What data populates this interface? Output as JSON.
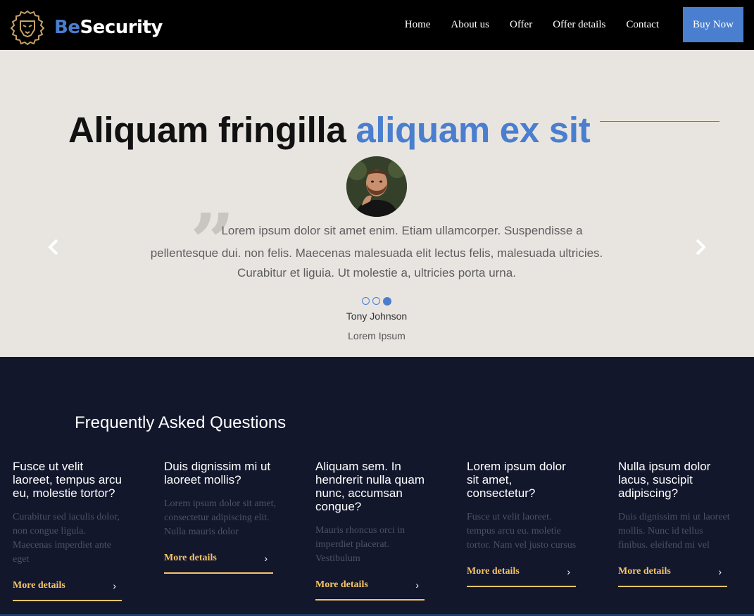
{
  "header": {
    "logo": {
      "be": "Be",
      "rest": "Security"
    },
    "nav": [
      "Home",
      "About us",
      "Offer",
      "Offer details",
      "Contact"
    ],
    "buy_now": "Buy Now"
  },
  "testimonial": {
    "title_main": "Aliquam fringilla",
    "title_accent": "aliquam ex sit",
    "quote_line1": "Lorem ipsum dolor sit amet enim. Etiam ullamcorper. Suspendisse a",
    "quote_line2": "pellentesque dui. non felis. Maecenas malesuada elit lectus felis, malesuada ultricies.",
    "quote_line3": "Curabitur et liguia. Ut molestie a, ultricies porta urna.",
    "name": "Tony Johnson",
    "role": "Lorem Ipsum",
    "slides": 3,
    "active_slide": 3
  },
  "faq": {
    "title": "Frequently Asked Questions",
    "items": [
      {
        "q": "Fusce ut velit laoreet, tempus arcu eu, molestie tortor?",
        "a": "Curabitur sed iaculis dolor, non congue ligula. Maecenas imperdiet ante eget",
        "more": "More details"
      },
      {
        "q": "Duis dignissim mi ut laoreet mollis?",
        "a": "Lorem ipsum dolor sit amet, consectetur adipiscing elit. Nulla mauris dolor",
        "more": "More details"
      },
      {
        "q": "Aliquam sem. In hendrerit nulla quam nunc, accumsan congue?",
        "a": "Mauris rhoncus orci in imperdiet placerat. Vestibulum",
        "more": "More details"
      },
      {
        "q": "Lorem ipsum dolor sit amet, consectetur?",
        "a": "Fusce ut velit laoreet. tempus arcu eu. moletie tortor. Nam vel justo cursus",
        "more": "More details"
      },
      {
        "q": "Nulla ipsum dolor lacus, suscipit adipiscing?",
        "a": "Duis dignissim mi ut laoreet mollis. Nunc id tellus finibus. eleifend mi vel",
        "more": "More details"
      }
    ]
  },
  "colors": {
    "accent": "#4a7ecf",
    "gold": "#f5c566",
    "dark": "#13172c",
    "light_bg": "#e8e5e1"
  }
}
